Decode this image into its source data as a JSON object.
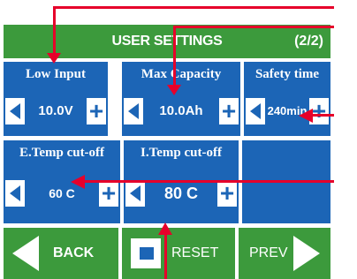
{
  "header": {
    "title": "USER SETTINGS",
    "page": "(2/2)"
  },
  "settings": [
    {
      "label": "Low Input",
      "value": "10.0V"
    },
    {
      "label": "Max Capacity",
      "value": "10.0Ah"
    },
    {
      "label": "Safety time",
      "value": "240min"
    },
    {
      "label": "E.Temp cut-off",
      "value": "60 C"
    },
    {
      "label": "I.Temp cut-off",
      "value": "80 C"
    }
  ],
  "footer": {
    "back": "BACK",
    "reset": "RESET",
    "prev": "PREV"
  },
  "colors": {
    "header": "#3c9a3c",
    "panel": "#1c65b6",
    "annotation": "#e6002a"
  }
}
